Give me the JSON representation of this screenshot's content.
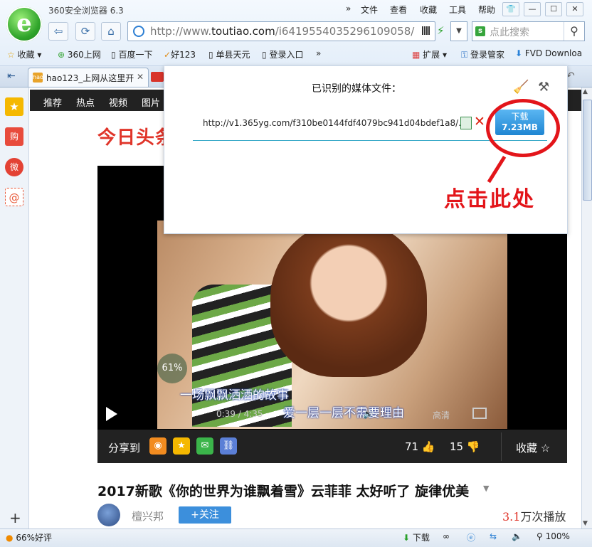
{
  "app": {
    "title": "360安全浏览器 6.3",
    "logo_letter": "e"
  },
  "menu": [
    "文件",
    "查看",
    "收藏",
    "工具",
    "帮助"
  ],
  "window_controls": [
    "👕",
    "—",
    "☐",
    "✕"
  ],
  "address": {
    "prefix": "http://www.",
    "domain": "toutiao.com",
    "path": "/i6419554035296109058/"
  },
  "search": {
    "placeholder": "点此搜索",
    "logo": "s"
  },
  "bookmarks": [
    "收藏",
    "360上网",
    "百度一下",
    "好123",
    "单县天元",
    "登录入口",
    "»",
    "扩展",
    "登录管家",
    "FVD Downloa"
  ],
  "tab": {
    "label": "hao123_上网从这里开",
    "fav": "hao"
  },
  "sidebar": [
    "★",
    "购",
    "微",
    "@"
  ],
  "site": {
    "nav": [
      "推荐",
      "热点",
      "视频",
      "图片"
    ],
    "brand": "今日头条"
  },
  "video": {
    "progress_badge": "61%",
    "lyric_line1": "一场飘飘洒洒的故事",
    "lyric_line2": "爱一层一层不需要理由",
    "time": "0:39 / 4:35",
    "quality": "高清",
    "share_label": "分享到",
    "likes": "71 👍",
    "dislikes": "15 👎",
    "favorite": "收藏 ☆"
  },
  "article": {
    "title": "2017新歌《你的世界为谁飘着雪》云菲菲 太好听了 旋律优美",
    "author": "檀兴邦",
    "follow": "+关注",
    "plays_num": "3.1",
    "plays_suffix": "万次播放"
  },
  "popup": {
    "title": "已识别的媒体文件：",
    "url": "http://v1.365yg.com/f310be0144fdf4079bc941d04bdef1a8/...",
    "download_label": "下载",
    "download_size": "7.23MB",
    "hint": "点击此处"
  },
  "status": {
    "rating": "66%好评",
    "download": "下载",
    "zoom": "100%"
  }
}
